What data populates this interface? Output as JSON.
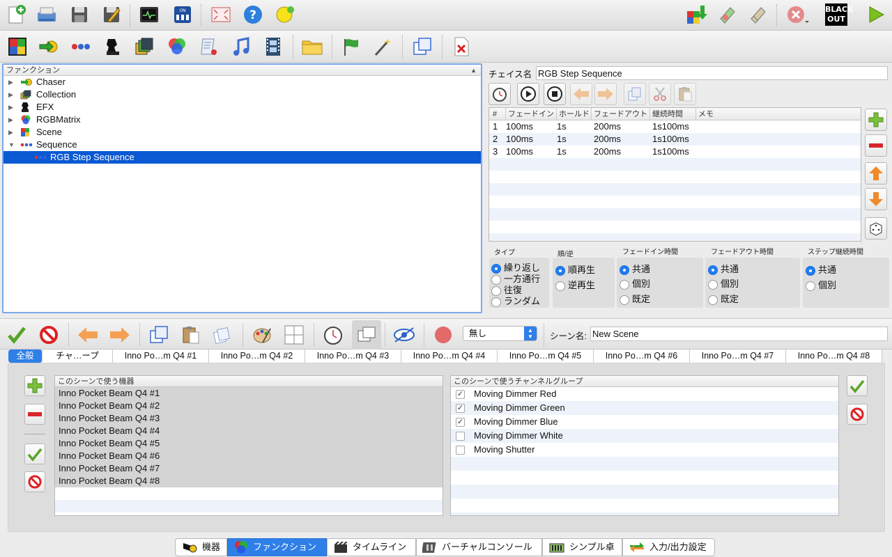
{
  "toolbar_main": {
    "icons": [
      "new-workspace-icon",
      "open-workspace-icon",
      "save-icon",
      "save-as-icon",
      "monitor-icon",
      "dmx-address-tool-icon",
      "fullscreen-icon",
      "help-icon",
      "bulb-icon",
      "dmx-dump-icon",
      "fixture-fade-icon",
      "edit-pencil-icon",
      "stop-all-icon",
      "blackout-icon",
      "play-icon"
    ],
    "blackout_label": "BLACK OUT"
  },
  "toolbar_functions": {
    "icons": [
      "scene-icon",
      "chaser-icon",
      "sequence-icon",
      "efx-icon",
      "collection-icon",
      "rgbmatrix-icon",
      "script-icon",
      "audio-icon",
      "video-icon",
      "folder-icon",
      "wizard-flag-icon",
      "magic-wand-icon",
      "clone-icon",
      "delete-icon"
    ]
  },
  "function_tree": {
    "header": "ファンクション",
    "items": [
      {
        "label": "Chaser",
        "icon": "chaser-icon",
        "expanded": false
      },
      {
        "label": "Collection",
        "icon": "collection-icon",
        "expanded": false
      },
      {
        "label": "EFX",
        "icon": "efx-icon",
        "expanded": false
      },
      {
        "label": "RGBMatrix",
        "icon": "rgbmatrix-icon",
        "expanded": false
      },
      {
        "label": "Scene",
        "icon": "scene-icon",
        "expanded": false
      },
      {
        "label": "Sequence",
        "icon": "sequence-icon",
        "expanded": true
      },
      {
        "label": "RGB Step Sequence",
        "icon": "sequence-icon",
        "selected": true
      }
    ]
  },
  "chaser_editor": {
    "name_label": "チェイス名",
    "name_value": "RGB Step Sequence",
    "columns": [
      "#",
      "フェードイン",
      "ホールド",
      "フェードアウト",
      "継続時間",
      "メモ"
    ],
    "rows": [
      [
        "1",
        "100ms",
        "1s",
        "200ms",
        "1s100ms",
        ""
      ],
      [
        "2",
        "100ms",
        "1s",
        "200ms",
        "1s100ms",
        ""
      ],
      [
        "3",
        "100ms",
        "1s",
        "200ms",
        "1s100ms",
        ""
      ]
    ],
    "groups": {
      "type": {
        "title": "タイプ",
        "options": [
          "繰り返し",
          "一方通行",
          "往復",
          "ランダム"
        ],
        "selected": 0
      },
      "direction": {
        "title": "順/逆",
        "options": [
          "順再生",
          "逆再生"
        ],
        "selected": 0
      },
      "fadein": {
        "title": "フェードイン時間",
        "options": [
          "共通",
          "個別",
          "既定"
        ],
        "selected": 0
      },
      "fadeout": {
        "title": "フェードアウト時間",
        "options": [
          "共通",
          "個別",
          "既定"
        ],
        "selected": 0
      },
      "step": {
        "title": "ステップ継続時間",
        "options": [
          "共通",
          "個別"
        ],
        "selected": 0
      }
    }
  },
  "scene_editor": {
    "fade_select": "無し",
    "scene_name_label": "シーン名:",
    "scene_name_value": "New Scene",
    "tabs": [
      "全般",
      "チャ…ープ",
      "Inno Po…m Q4 #1",
      "Inno Po…m Q4 #2",
      "Inno Po…m Q4 #3",
      "Inno Po…m Q4 #4",
      "Inno Po…m Q4 #5",
      "Inno Po…m Q4 #6",
      "Inno Po…m Q4 #7",
      "Inno Po…m Q4 #8"
    ],
    "active_tab": 0,
    "fixtures_header": "このシーンで使う機器",
    "fixtures": [
      "Inno Pocket Beam Q4 #1",
      "Inno Pocket Beam Q4 #2",
      "Inno Pocket Beam Q4 #3",
      "Inno Pocket Beam Q4 #4",
      "Inno Pocket Beam Q4 #5",
      "Inno Pocket Beam Q4 #6",
      "Inno Pocket Beam Q4 #7",
      "Inno Pocket Beam Q4 #8"
    ],
    "groups_header": "このシーンで使うチャンネルグループ",
    "channel_groups": [
      {
        "label": "Moving Dimmer Red",
        "checked": true
      },
      {
        "label": "Moving Dimmer Green",
        "checked": true
      },
      {
        "label": "Moving Dimmer Blue",
        "checked": true
      },
      {
        "label": "Moving Dimmer White",
        "checked": false
      },
      {
        "label": "Moving Shutter",
        "checked": false
      }
    ]
  },
  "bottom_tabs": [
    {
      "label": "機器",
      "icon": "fixture-icon"
    },
    {
      "label": "ファンクション",
      "icon": "function-icon",
      "active": true
    },
    {
      "label": "タイムライン",
      "icon": "timeline-icon"
    },
    {
      "label": "バーチャルコンソール",
      "icon": "virtual-console-icon"
    },
    {
      "label": "シンプル卓",
      "icon": "simple-desk-icon"
    },
    {
      "label": "入力/出力設定",
      "icon": "io-icon"
    }
  ],
  "colors": {
    "accent": "#1f7cf2",
    "selection": "#0b59d3",
    "add_green": "#5aab2f",
    "remove_red": "#d8262a"
  }
}
